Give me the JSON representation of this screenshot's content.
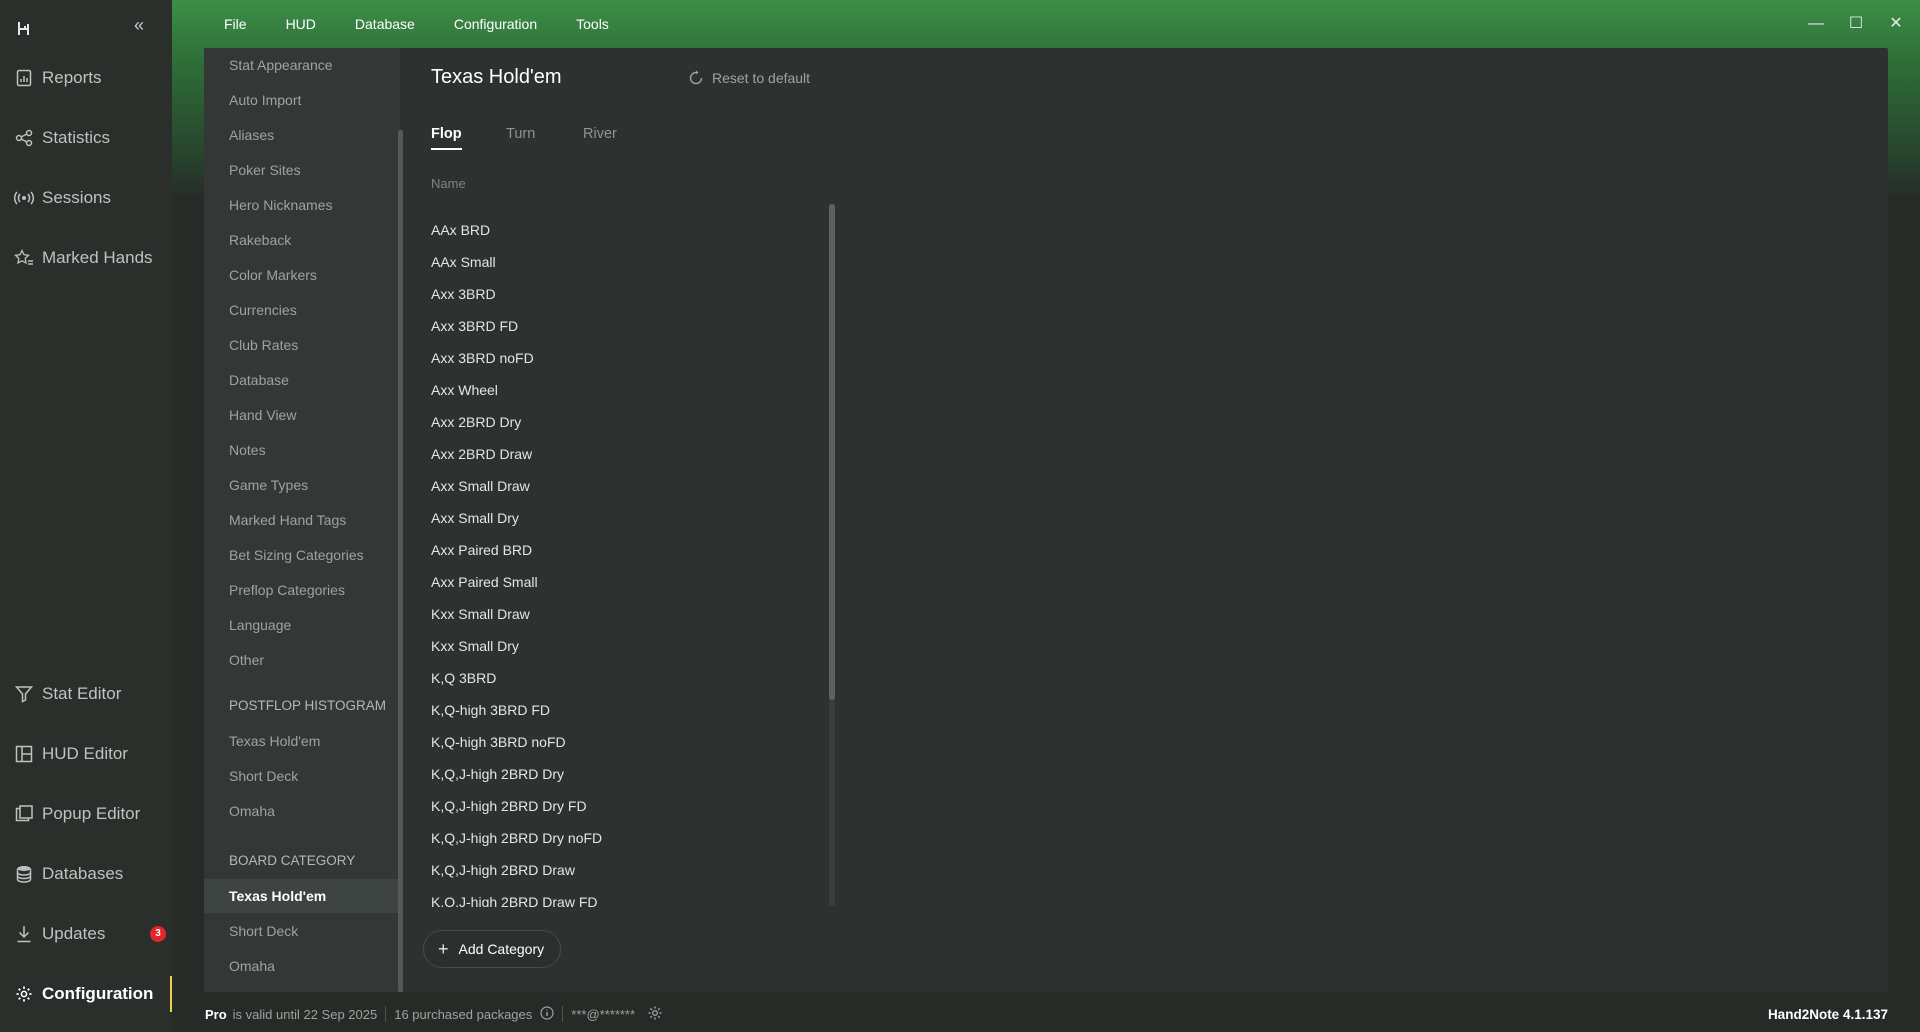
{
  "nav": {
    "items_top": [
      {
        "label": "Reports",
        "icon": "reports-icon"
      },
      {
        "label": "Statistics",
        "icon": "statistics-icon"
      },
      {
        "label": "Sessions",
        "icon": "sessions-icon"
      },
      {
        "label": "Marked Hands",
        "icon": "marked-hands-icon"
      }
    ],
    "items_bottom": [
      {
        "label": "Stat Editor",
        "icon": "filter-icon"
      },
      {
        "label": "HUD Editor",
        "icon": "hud-editor-icon"
      },
      {
        "label": "Popup Editor",
        "icon": "popup-editor-icon"
      },
      {
        "label": "Databases",
        "icon": "database-icon"
      },
      {
        "label": "Updates",
        "icon": "download-icon",
        "badge": "3"
      },
      {
        "label": "Configuration",
        "icon": "gear-icon",
        "active": true
      }
    ]
  },
  "menu": [
    "File",
    "HUD",
    "Database",
    "Configuration",
    "Tools"
  ],
  "settings": {
    "items": [
      "Stat Appearance",
      "Auto Import",
      "Aliases",
      "Poker Sites",
      "Hero Nicknames",
      "Rakeback",
      "Color Markers",
      "Currencies",
      "Club Rates",
      "Database",
      "Hand View",
      "Notes",
      "Game Types",
      "Marked Hand Tags",
      "Bet Sizing Categories",
      "Preflop Categories",
      "Language",
      "Other"
    ],
    "postflop_heading": "POSTFLOP HISTOGRAM",
    "postflop_items": [
      "Texas Hold'em",
      "Short Deck",
      "Omaha"
    ],
    "board_heading": "BOARD CATEGORY",
    "board_items": [
      "Texas Hold'em",
      "Short Deck",
      "Omaha"
    ],
    "active": "Texas Hold'em"
  },
  "content": {
    "title": "Texas Hold'em",
    "reset_label": "Reset to default",
    "tabs": [
      "Flop",
      "Turn",
      "River"
    ],
    "active_tab": "Flop",
    "column_header": "Name",
    "rows": [
      "AAx BRD",
      "AAx Small",
      "Axx 3BRD",
      "Axx 3BRD FD",
      "Axx 3BRD noFD",
      "Axx Wheel",
      "Axx 2BRD Dry",
      "Axx 2BRD Draw",
      "Axx Small Draw",
      "Axx Small Dry",
      "Axx Paired BRD",
      "Axx Paired Small",
      "Kxx Small Draw",
      "Kxx Small Dry",
      "K,Q 3BRD",
      "K,Q-high 3BRD FD",
      "K,Q-high 3BRD noFD",
      "K,Q,J-high 2BRD Dry",
      "K,Q,J-high 2BRD Dry FD",
      "K,Q,J-high 2BRD Dry noFD",
      "K,Q,J-high 2BRD Draw",
      "K,Q,J-high 2BRD Draw FD"
    ],
    "add_button": "Add Category"
  },
  "status": {
    "plan": "Pro",
    "validity": "is valid until 22 Sep 2025",
    "packages": "16 purchased packages",
    "account": "***@*******",
    "version": "Hand2Note 4.1.137"
  },
  "colors": {
    "accent_green": "#3c8f47",
    "active_indicator": "#e9d34a",
    "badge_red": "#e0262b"
  }
}
